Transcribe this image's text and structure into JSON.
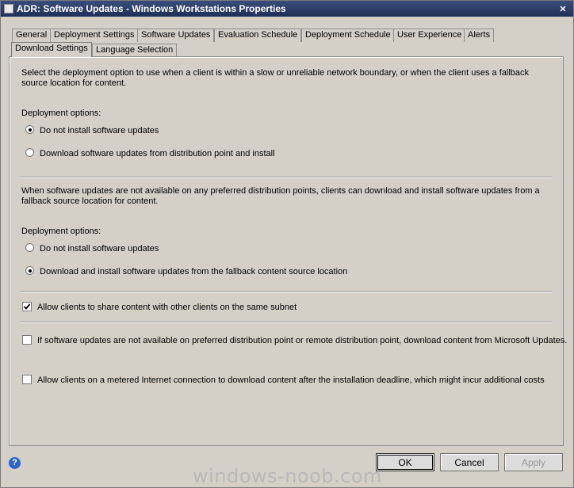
{
  "window": {
    "title": "ADR: Software Updates - Windows Workstations Properties",
    "close_glyph": "✕"
  },
  "tabs_row1": [
    "General",
    "Deployment Settings",
    "Software Updates",
    "Evaluation Schedule",
    "Deployment Schedule",
    "User Experience",
    "Alerts"
  ],
  "tabs_row2": [
    "Download Settings",
    "Language Selection"
  ],
  "section1": {
    "description": "Select the deployment option to use when a client is within a slow or unreliable network boundary, or when the client uses a fallback source location for content.",
    "options_label": "Deployment options:",
    "option1": "Do not install software updates",
    "option2": "Download software updates from distribution point and install",
    "selected": 1
  },
  "section2": {
    "description": "When software updates are not available on any preferred distribution points, clients can download and install software updates from a fallback source location for content.",
    "options_label": "Deployment options:",
    "option1": "Do not install software updates",
    "option2": "Download and install software updates from the fallback content source location",
    "selected": 2
  },
  "checkboxes": {
    "share_subnet": {
      "label": "Allow clients to share content with other clients on the same subnet",
      "checked": true
    },
    "microsoft_updates": {
      "label": "If software updates are not available on preferred distribution point or remote distribution point, download content from Microsoft Updates.",
      "checked": false
    },
    "metered": {
      "label": "Allow clients on a metered Internet connection to download content after the installation deadline, which might incur additional costs",
      "checked": false
    }
  },
  "buttons": {
    "ok": "OK",
    "cancel": "Cancel",
    "apply": "Apply"
  },
  "help_glyph": "?",
  "watermark": "windows-noob.com"
}
